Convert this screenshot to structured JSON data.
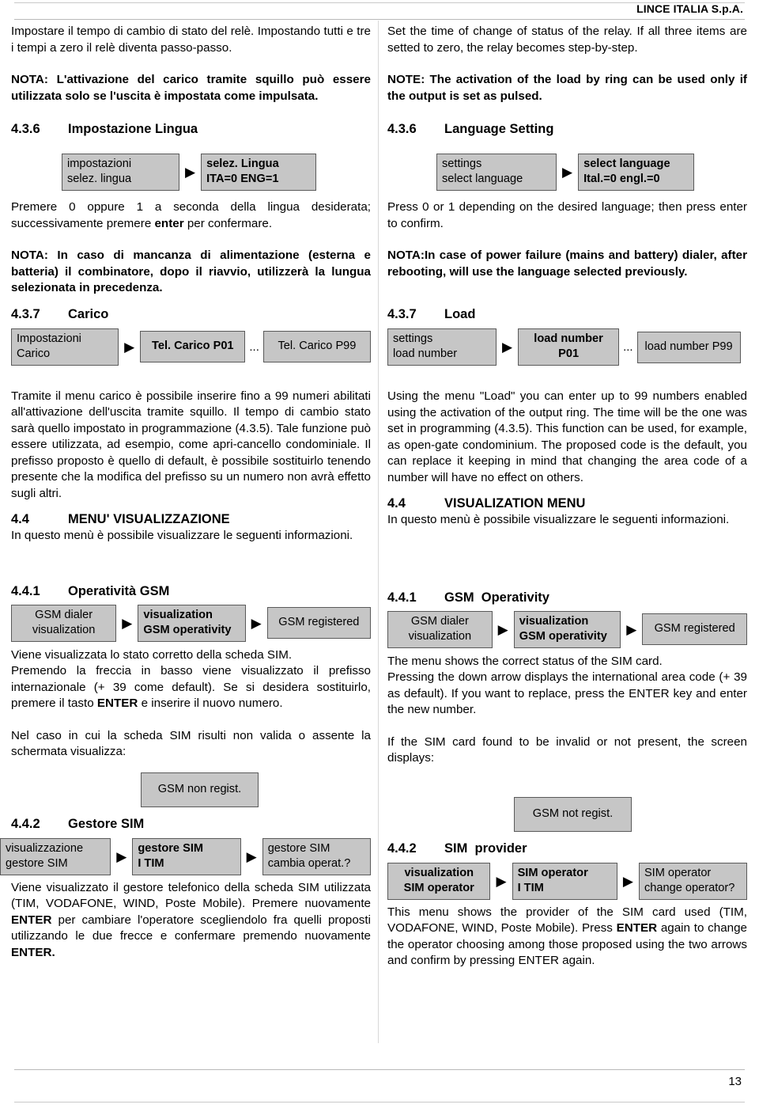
{
  "header": {
    "company": "LINCE ITALIA S.p.A."
  },
  "footer": {
    "page_number": "13"
  },
  "left_column": {
    "intro_paragraph": "Impostare il tempo di cambio di stato del relè. Impostando tutti e tre i tempi a zero il relè diventa passo-passo.",
    "note_relay": "NOTA: L'attivazione del carico tramite squillo può essere utilizzata solo se l'uscita è impostata come impulsata.",
    "sec_436_num": "4.3.6",
    "sec_436_title": "Impostazione Lingua",
    "lang_box1_line1": "impostazioni",
    "lang_box1_line2": "selez. lingua",
    "lang_box2_line1": "selez. Lingua",
    "lang_box2_line2": "ITA=0    ENG=1",
    "lang_paragraph_pre": "Premere 0 oppure 1 a seconda della lingua desiderata; successivamente premere ",
    "lang_paragraph_bold": "enter",
    "lang_paragraph_post": " per confermare.",
    "note_power": "NOTA: In caso di mancanza di alimentazione (esterna e batteria) il combinatore, dopo il riavvio, utilizzerà la lungua selezionata in precedenza.",
    "sec_437_num": "4.3.7",
    "sec_437_title": "Carico",
    "load_box1_line1": "Impostazioni",
    "load_box1_line2": "Carico",
    "load_box2": "Tel. Carico P01",
    "load_dots": "...",
    "load_box3": "Tel. Carico P99",
    "load_paragraph": "Tramite il menu carico è possibile inserire fino a 99 numeri abilitati all'attivazione dell'uscita tramite squillo. Il tempo di cambio stato sarà quello impostato in programmazione (4.3.5). Tale funzione può essere utilizzata, ad esempio, come apri-cancello condominiale. Il prefisso proposto è quello di default, è possibile sostituirlo tenendo presente che la modifica del prefisso su un numero non avrà effetto sugli altri.",
    "sec_44_num": "4.4",
    "sec_44_title": "MENU' VISUALIZZAZIONE",
    "sec_44_paragraph": "In questo menù è possibile visualizzare le seguenti informazioni.",
    "sec_441_num": "4.4.1",
    "sec_441_title": "Operatività GSM",
    "gsm_box1_line1": "GSM dialer",
    "gsm_box1_line2": "visualization",
    "gsm_box2_line1": "visualization",
    "gsm_box2_line2": "GSM operativity",
    "gsm_box3": "GSM registered",
    "gsm_paragraph_line1": "Viene visualizzata lo stato corretto della scheda SIM.",
    "gsm_paragraph_pre": "Premendo la freccia in basso viene visualizzato il prefisso internazionale (+ 39 come default). Se si desidera sostituirlo, premere il tasto ",
    "gsm_paragraph_bold": "ENTER",
    "gsm_paragraph_post": " e inserire il nuovo numero.",
    "sim_invalid_paragraph": "Nel caso in cui la scheda SIM risulti non valida o assente la schermata visualizza:",
    "gsm_not_reg_box": "GSM non regist.",
    "sec_442_num": "4.4.2",
    "sec_442_title": "Gestore SIM",
    "sim_box1_line1": "visualizzazione",
    "sim_box1_line2": "gestore SIM",
    "sim_box2_line1": "gestore SIM",
    "sim_box2_line2": " I TIM",
    "sim_box3_line1": "gestore SIM",
    "sim_box3_line2": "cambia operat.?",
    "sim_paragraph_1": "Viene visualizzato il gestore telefonico della scheda SIM utilizzata (TIM, VODAFONE, WIND, Poste Mobile). Premere nuovamente ",
    "sim_paragraph_b1": "ENTER",
    "sim_paragraph_2": " per cambiare l'operatore scegliendolo fra quelli proposti utilizzando le due frecce e confermare premendo nuovamente ",
    "sim_paragraph_b2": "ENTER."
  },
  "right_column": {
    "intro_paragraph": "Set the time of change of status of the relay. If  all three items are setted to zero, the relay becomes step-by-step.",
    "note_relay": "NOTE: The activation of the load by ring can be used only if the output is set as pulsed.",
    "sec_436_num": "4.3.6",
    "sec_436_title": "Language Setting",
    "lang_box1_line1": "settings",
    "lang_box1_line2": "select language",
    "lang_box2_line1": "select language",
    "lang_box2_line2": "Ital.=0    engl.=0",
    "lang_paragraph": "Press 0 or 1 depending on the desired language; then press enter to confirm.",
    "note_power": "NOTA:In case of power failure (mains and battery) dialer, after rebooting, will use the language selected previously.",
    "sec_437_num": "4.3.7",
    "sec_437_title": "Load",
    "load_box1_line1": "settings",
    "load_box1_line2": " load number",
    "load_box2": "load number P01",
    "load_dots": "...",
    "load_box3": "load number P99",
    "load_paragraph": "Using the menu \"Load\" you can enter up to 99 numbers enabled using the activation of the output ring. The time  will be the one was set in programming (4.3.5). This function can be used, for example, as open-gate condominium. The proposed code is the default, you can replace it keeping in mind that changing the area code of a number will have no effect on others.",
    "sec_44_num": "4.4",
    "sec_44_title": "VISUALIZATION MENU",
    "sec_44_paragraph": "In questo menù è possibile visualizzare le seguenti informazioni.",
    "sec_441_num": "4.4.1",
    "sec_441_title": "GSM  Operativity",
    "gsm_box1_line1": "GSM dialer",
    "gsm_box1_line2": "visualization",
    "gsm_box2_line1": "visualization",
    "gsm_box2_line2": "GSM operativity",
    "gsm_box3": "GSM registered",
    "gsm_paragraph_line1": "The menu shows the correct status of the SIM card.",
    "gsm_paragraph_rest": "Pressing the down arrow displays the international area code (+ 39 as default). If you want to replace, press the ENTER key and enter the new number.",
    "sim_invalid_paragraph": "If the SIM card found to be invalid or not present, the screen displays:",
    "gsm_not_reg_box": "GSM not regist.",
    "sec_442_num": "4.4.2",
    "sec_442_title": "SIM  provider",
    "sim_box1_line1": "visualization",
    "sim_box1_line2": "SIM operator",
    "sim_box2_line1": "SIM operator",
    "sim_box2_line2": "I TIM",
    "sim_box3_line1": "SIM operator",
    "sim_box3_line2": "change operator?",
    "sim_paragraph_1": "This menu shows the provider of the SIM card used (TIM, VODAFONE, WIND, Poste Mobile). Press ",
    "sim_paragraph_b1": "ENTER",
    "sim_paragraph_2": " again to change the operator choosing among those proposed using the two arrows and confirm by pressing ENTER again."
  },
  "icons": {
    "arrow": "▶"
  }
}
